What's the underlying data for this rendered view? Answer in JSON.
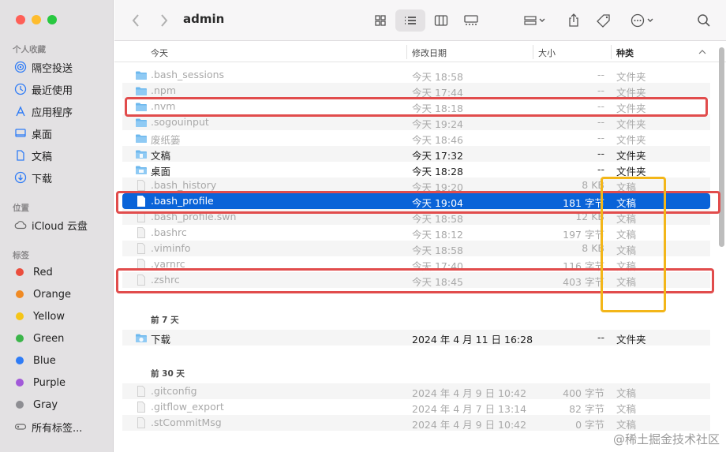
{
  "window": {
    "title": "admin"
  },
  "sidebar": {
    "favorites_header": "个人收藏",
    "favorites": [
      {
        "label": "隔空投送",
        "icon": "airdrop-icon"
      },
      {
        "label": "最近使用",
        "icon": "clock-icon"
      },
      {
        "label": "应用程序",
        "icon": "applications-icon"
      },
      {
        "label": "桌面",
        "icon": "desktop-icon"
      },
      {
        "label": "文稿",
        "icon": "document-icon"
      },
      {
        "label": "下载",
        "icon": "download-icon"
      }
    ],
    "locations_header": "位置",
    "locations": [
      {
        "label": "iCloud 云盘",
        "icon": "cloud-icon"
      }
    ],
    "tags_header": "标签",
    "tags": [
      {
        "label": "Red",
        "color": "#eb4d3d"
      },
      {
        "label": "Orange",
        "color": "#f08a24"
      },
      {
        "label": "Yellow",
        "color": "#f5c518"
      },
      {
        "label": "Green",
        "color": "#3bb54a"
      },
      {
        "label": "Blue",
        "color": "#2f7cf6"
      },
      {
        "label": "Purple",
        "color": "#a259d9"
      },
      {
        "label": "Gray",
        "color": "#8e8e93"
      }
    ],
    "all_tags": "所有标签..."
  },
  "columns": {
    "name": "今天",
    "date": "修改日期",
    "size": "大小",
    "kind": "种类"
  },
  "groups": {
    "today_rows": [
      {
        "name": ".bash_sessions",
        "date": "今天 18:58",
        "size": "--",
        "kind": "文件夹",
        "type": "folder",
        "hidden": true
      },
      {
        "name": ".npm",
        "date": "今天 17:44",
        "size": "--",
        "kind": "文件夹",
        "type": "folder",
        "hidden": true
      },
      {
        "name": ".nvm",
        "date": "今天 18:18",
        "size": "--",
        "kind": "文件夹",
        "type": "folder",
        "hidden": true
      },
      {
        "name": ".sogouinput",
        "date": "今天 19:24",
        "size": "--",
        "kind": "文件夹",
        "type": "folder",
        "hidden": true
      },
      {
        "name": "废纸篓",
        "date": "今天 18:46",
        "size": "--",
        "kind": "文件夹",
        "type": "folder",
        "hidden": true
      },
      {
        "name": "文稿",
        "date": "今天 17:32",
        "size": "--",
        "kind": "文件夹",
        "type": "folder-doc",
        "hidden": false
      },
      {
        "name": "桌面",
        "date": "今天 18:28",
        "size": "--",
        "kind": "文件夹",
        "type": "folder-desktop",
        "hidden": false
      },
      {
        "name": ".bash_history",
        "date": "今天 19:20",
        "size": "8 KB",
        "kind": "文稿",
        "type": "file",
        "hidden": true
      },
      {
        "name": ".bash_profile",
        "date": "今天 19:04",
        "size": "181 字节",
        "kind": "文稿",
        "type": "file",
        "hidden": true,
        "selected": true
      },
      {
        "name": ".bash_profile.swn",
        "date": "今天 18:58",
        "size": "12 KB",
        "kind": "文稿",
        "type": "file",
        "hidden": true
      },
      {
        "name": ".bashrc",
        "date": "今天 18:12",
        "size": "197 字节",
        "kind": "文稿",
        "type": "file",
        "hidden": true
      },
      {
        "name": ".viminfo",
        "date": "今天 18:58",
        "size": "8 KB",
        "kind": "文稿",
        "type": "file",
        "hidden": true
      },
      {
        "name": ".yarnrc",
        "date": "今天 17:40",
        "size": "116 字节",
        "kind": "文稿",
        "type": "file",
        "hidden": true
      },
      {
        "name": ".zshrc",
        "date": "今天 18:45",
        "size": "403 字节",
        "kind": "文稿",
        "type": "file",
        "hidden": true
      }
    ],
    "week_header": "前 7 天",
    "week_rows": [
      {
        "name": "下载",
        "date": "2024 年 4 月 11 日 16:28",
        "size": "--",
        "kind": "文件夹",
        "type": "folder-download",
        "hidden": false
      }
    ],
    "month_header": "前 30 天",
    "month_rows": [
      {
        "name": ".gitconfig",
        "date": "2024 年 4 月 9 日 10:42",
        "size": "400 字节",
        "kind": "文稿",
        "type": "file",
        "hidden": true
      },
      {
        "name": ".gitflow_export",
        "date": "2024 年 4 月 7 日 13:14",
        "size": "82 字节",
        "kind": "文稿",
        "type": "file",
        "hidden": true
      },
      {
        "name": ".stCommitMsg",
        "date": "2024 年 4 月 9 日 10:42",
        "size": "0 字节",
        "kind": "文稿",
        "type": "file",
        "hidden": true
      }
    ]
  },
  "watermark": "@稀土掘金技术社区",
  "colors": {
    "selection": "#0a63d8",
    "highlight_red": "#e14c4c",
    "highlight_yellow": "#f3b619",
    "folder": "#6cb8ee"
  }
}
